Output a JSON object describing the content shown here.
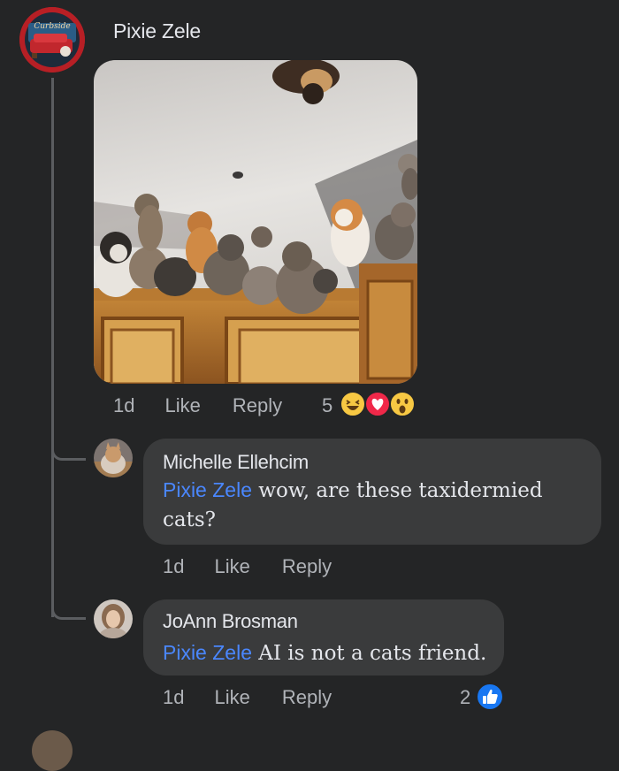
{
  "post": {
    "author": "Pixie Zele",
    "avatar_icon": "curbside-logo-avatar",
    "image_icon": "cats-on-cabinet-photo",
    "time": "1d",
    "like_label": "Like",
    "reply_label": "Reply",
    "reaction_count": "5",
    "reactions": [
      "haha-icon",
      "love-icon",
      "wow-icon"
    ]
  },
  "replies": [
    {
      "author": "Michelle Ellehcim",
      "mention": "Pixie Zele",
      "text": " wow, are these taxidermied cats?",
      "text_line1": " wow, are these taxidermied",
      "text_line2": "cats?",
      "time": "1d",
      "like_label": "Like",
      "reply_label": "Reply"
    },
    {
      "author": "JoAnn Brosman",
      "mention": "Pixie Zele",
      "text": " AI is not a cats friend.",
      "time": "1d",
      "like_label": "Like",
      "reply_label": "Reply",
      "reaction_count": "2",
      "reaction": "like-icon"
    }
  ],
  "colors": {
    "background": "#242526",
    "bubble": "#3a3b3c",
    "mention": "#4a87ff",
    "meta_text": "#b0b3b8",
    "like_blue": "#1877f2"
  }
}
